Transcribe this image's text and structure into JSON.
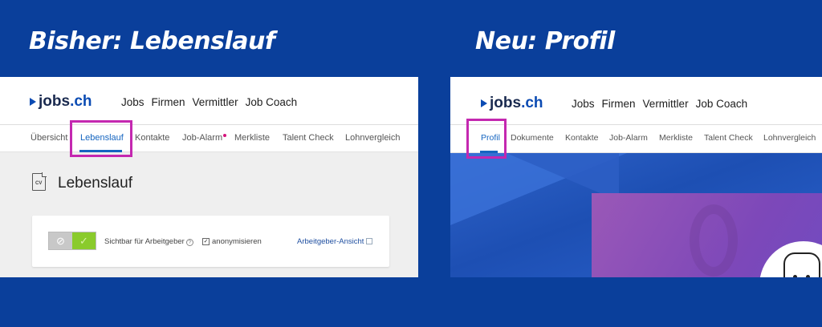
{
  "headings": {
    "left": "Bisher: Lebenslauf",
    "right": "Neu: Profil"
  },
  "brand": {
    "logo_text_main": "jobs",
    "logo_text_tld": ".ch"
  },
  "mainnav": [
    "Jobs",
    "Firmen",
    "Vermittler",
    "Job Coach"
  ],
  "old": {
    "subnav": [
      "Übersicht",
      "Lebenslauf",
      "Kontakte",
      "Job-Alarm",
      "Merkliste",
      "Talent Check",
      "Lohnvergleich"
    ],
    "active_tab": "Lebenslauf",
    "page_title": "Lebenslauf",
    "cv_icon_label": "CV",
    "visibility_label": "Sichtbar für Arbeitgeber",
    "anonymize_label": "anonymisieren",
    "employer_view_link": "Arbeitgeber-Ansicht",
    "visibility_on": true,
    "anonymize_checked": true
  },
  "new": {
    "subnav": [
      "Profil",
      "Dokumente",
      "Kontakte",
      "Job-Alarm",
      "Merkliste",
      "Talent Check",
      "Lohnvergleich"
    ],
    "active_tab": "Profil"
  },
  "colors": {
    "background": "#0a3f9b",
    "accent": "#1565c0",
    "highlight": "#c428b0",
    "toggle_on": "#8acb2c"
  }
}
